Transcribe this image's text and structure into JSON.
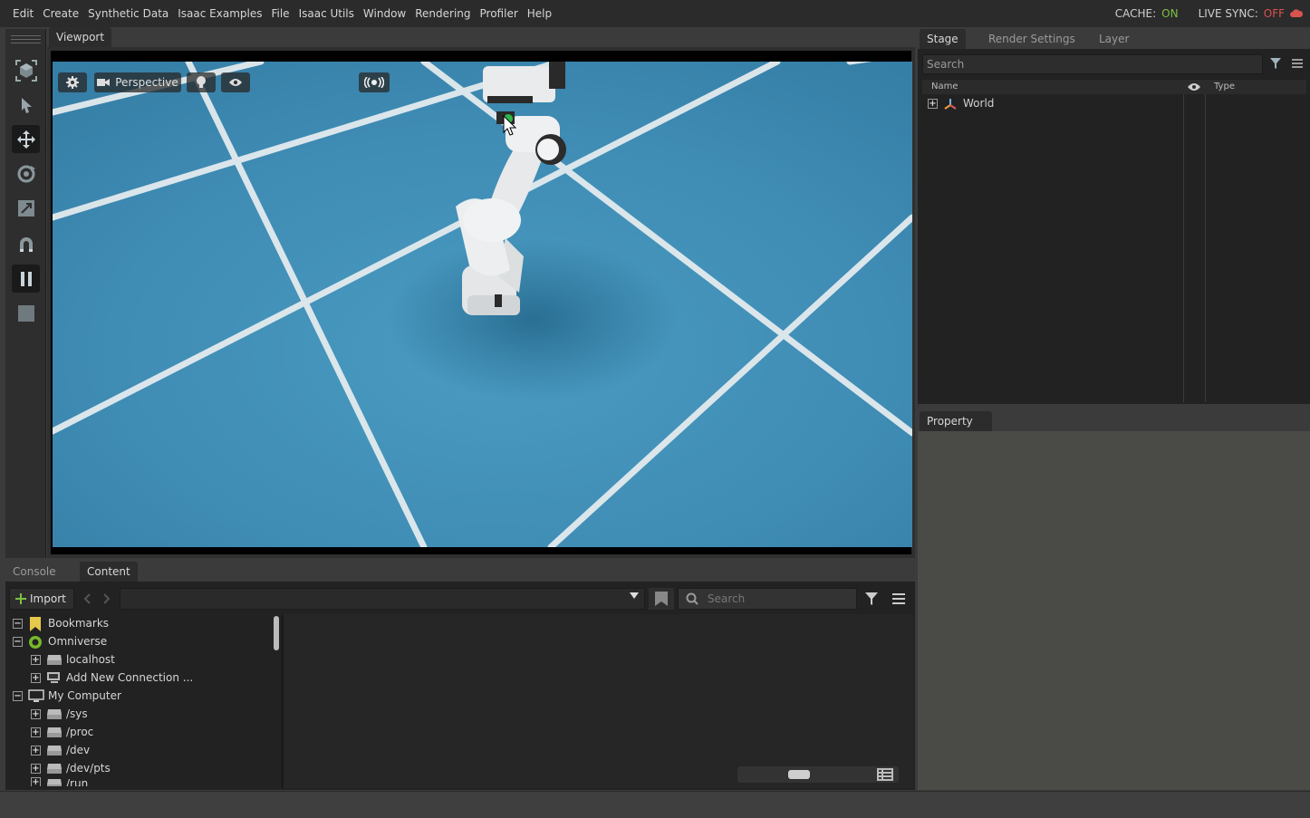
{
  "menu": [
    "Edit",
    "Create",
    "Synthetic Data",
    "Isaac Examples",
    "File",
    "Isaac Utils",
    "Window",
    "Rendering",
    "Profiler",
    "Help"
  ],
  "status": {
    "cache_label": "CACHE:",
    "cache_value": "ON",
    "live_sync_label": "LIVE SYNC:",
    "live_sync_value": "OFF"
  },
  "viewport": {
    "tab": "Viewport",
    "camera": "Perspective"
  },
  "stage": {
    "tabs": [
      "Stage",
      "Render Settings",
      "Layer"
    ],
    "search_placeholder": "Search",
    "columns": {
      "name": "Name",
      "type": "Type"
    },
    "items": [
      {
        "label": "World"
      }
    ]
  },
  "property": {
    "tab": "Property"
  },
  "bottom": {
    "tabs": [
      "Console",
      "Content"
    ],
    "import_label": "Import",
    "search_placeholder": "Search",
    "tree": [
      {
        "label": "Bookmarks",
        "level": 0,
        "expander": "−",
        "icon": "bookmark-icon"
      },
      {
        "label": "Omniverse",
        "level": 0,
        "expander": "−",
        "icon": "omniverse-icon"
      },
      {
        "label": "localhost",
        "level": 1,
        "expander": "+",
        "icon": "server-icon"
      },
      {
        "label": "Add New Connection ...",
        "level": 1,
        "expander": "+",
        "icon": "add-connection-icon"
      },
      {
        "label": "My Computer",
        "level": 0,
        "expander": "−",
        "icon": "computer-icon"
      },
      {
        "label": "/sys",
        "level": 1,
        "expander": "+",
        "icon": "drive-icon"
      },
      {
        "label": "/proc",
        "level": 1,
        "expander": "+",
        "icon": "drive-icon"
      },
      {
        "label": "/dev",
        "level": 1,
        "expander": "+",
        "icon": "drive-icon"
      },
      {
        "label": "/dev/pts",
        "level": 1,
        "expander": "+",
        "icon": "drive-icon"
      },
      {
        "label": "/run",
        "level": 1,
        "expander": "+",
        "icon": "drive-icon"
      }
    ]
  },
  "colors": {
    "accent_on": "#7bc143",
    "accent_off": "#d9534f",
    "floor": "#3d88b0"
  }
}
